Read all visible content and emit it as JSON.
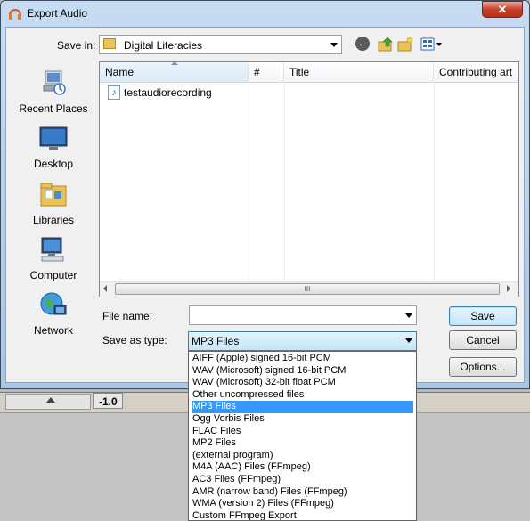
{
  "dialog": {
    "title": "Export Audio",
    "close_label": "✕"
  },
  "save_in": {
    "label": "Save in:",
    "value": "Digital Literacies"
  },
  "toolbar": {
    "back_label": "←"
  },
  "places": [
    {
      "label": "Recent Places",
      "icon": "recent-places-icon"
    },
    {
      "label": "Desktop",
      "icon": "desktop-icon"
    },
    {
      "label": "Libraries",
      "icon": "libraries-icon"
    },
    {
      "label": "Computer",
      "icon": "computer-icon"
    },
    {
      "label": "Network",
      "icon": "network-icon"
    }
  ],
  "file_list": {
    "columns": [
      "Name",
      "#",
      "Title",
      "Contributing art"
    ],
    "files": [
      {
        "name": "testaudiorecording",
        "icon": "audio-file-icon"
      }
    ],
    "scroll_grip": "III"
  },
  "file_name": {
    "label": "File name:",
    "value": ""
  },
  "save_as_type": {
    "label": "Save as type:",
    "value": "MP3 Files",
    "options": [
      "AIFF (Apple) signed 16-bit PCM",
      "WAV (Microsoft) signed 16-bit PCM",
      "WAV (Microsoft) 32-bit float PCM",
      "Other uncompressed files",
      "MP3 Files",
      "Ogg Vorbis Files",
      "FLAC Files",
      "MP2 Files",
      "(external program)",
      "M4A (AAC) Files (FFmpeg)",
      "AC3 Files (FFmpeg)",
      "AMR (narrow band) Files (FFmpeg)",
      "WMA (version 2) Files (FFmpeg)",
      "Custom FFmpeg Export"
    ],
    "selected_index": 4
  },
  "buttons": {
    "save": "Save",
    "cancel": "Cancel",
    "options": "Options..."
  },
  "background_app": {
    "ruler_value": "-1.0"
  },
  "colors": {
    "selection": "#3399ff",
    "title_gradient_top": "#c7dcf2",
    "close_button": "#c7412b"
  }
}
